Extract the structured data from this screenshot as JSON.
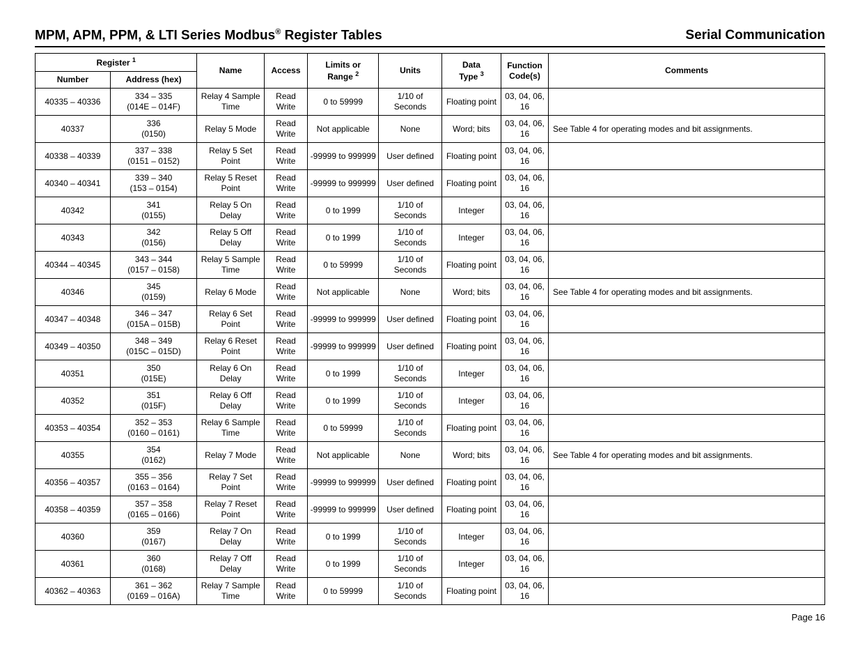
{
  "header": {
    "title_left_prefix": "MPM, APM, PPM, & LTI Series Modbus",
    "title_left_suffix": " Register Tables",
    "reg_mark": "®",
    "title_right": "Serial Communication"
  },
  "footer": {
    "page_label": "Page 16"
  },
  "columns": {
    "register_group": "Register",
    "register_fn": "1",
    "number": "Number",
    "address": "Address (hex)",
    "name": "Name",
    "access": "Access",
    "limits_l1": "Limits or",
    "limits_l2": "Range",
    "limits_fn": "2",
    "units": "Units",
    "data_l1": "Data",
    "data_l2": "Type",
    "data_fn": "3",
    "func_l1": "Function",
    "func_l2": "Code(s)",
    "comments": "Comments"
  },
  "rows": [
    {
      "number": "40335 – 40336",
      "addr1": "334 – 335",
      "addr2": "(014E – 014F)",
      "name": "Relay 4 Sample Time",
      "access": "Read Write",
      "limits": "0 to 59999",
      "units": "1/10 of Seconds",
      "dtype": "Floating point",
      "func": "03, 04, 06, 16",
      "comments": ""
    },
    {
      "number": "40337",
      "addr1": "336",
      "addr2": "(0150)",
      "name": "Relay 5 Mode",
      "access": "Read Write",
      "limits": "Not applicable",
      "units": "None",
      "dtype": "Word; bits",
      "func": "03, 04, 06, 16",
      "comments": "See Table 4 for operating modes and bit assignments."
    },
    {
      "number": "40338 – 40339",
      "addr1": "337 – 338",
      "addr2": "(0151 – 0152)",
      "name": "Relay 5 Set Point",
      "access": "Read Write",
      "limits": "-99999 to 999999",
      "units": "User defined",
      "dtype": "Floating point",
      "func": "03, 04, 06, 16",
      "comments": ""
    },
    {
      "number": "40340 – 40341",
      "addr1": "339 – 340",
      "addr2": "(153 – 0154)",
      "name": "Relay 5 Reset Point",
      "access": "Read Write",
      "limits": "-99999 to 999999",
      "units": "User defined",
      "dtype": "Floating point",
      "func": "03, 04, 06, 16",
      "comments": ""
    },
    {
      "number": "40342",
      "addr1": "341",
      "addr2": "(0155)",
      "name": "Relay 5 On Delay",
      "access": "Read Write",
      "limits": "0 to 1999",
      "units": "1/10 of Seconds",
      "dtype": "Integer",
      "func": "03, 04, 06, 16",
      "comments": ""
    },
    {
      "number": "40343",
      "addr1": "342",
      "addr2": "(0156)",
      "name": "Relay 5 Off Delay",
      "access": "Read Write",
      "limits": "0 to 1999",
      "units": "1/10 of Seconds",
      "dtype": "Integer",
      "func": "03, 04, 06, 16",
      "comments": ""
    },
    {
      "number": "40344 – 40345",
      "addr1": "343 – 344",
      "addr2": "(0157 – 0158)",
      "name": "Relay 5 Sample Time",
      "access": "Read Write",
      "limits": "0 to 59999",
      "units": "1/10 of Seconds",
      "dtype": "Floating point",
      "func": "03, 04, 06, 16",
      "comments": ""
    },
    {
      "number": "40346",
      "addr1": "345",
      "addr2": "(0159)",
      "name": "Relay 6 Mode",
      "access": "Read Write",
      "limits": "Not applicable",
      "units": "None",
      "dtype": "Word; bits",
      "func": "03, 04, 06, 16",
      "comments": "See Table 4 for operating modes and bit assignments."
    },
    {
      "number": "40347 – 40348",
      "addr1": "346 – 347",
      "addr2": "(015A – 015B)",
      "name": "Relay 6 Set Point",
      "access": "Read Write",
      "limits": "-99999 to 999999",
      "units": "User defined",
      "dtype": "Floating point",
      "func": "03, 04, 06, 16",
      "comments": ""
    },
    {
      "number": "40349 – 40350",
      "addr1": "348 – 349",
      "addr2": "(015C – 015D)",
      "name": "Relay 6 Reset Point",
      "access": "Read Write",
      "limits": "-99999 to 999999",
      "units": "User defined",
      "dtype": "Floating point",
      "func": "03, 04, 06, 16",
      "comments": ""
    },
    {
      "number": "40351",
      "addr1": "350",
      "addr2": "(015E)",
      "name": "Relay 6 On Delay",
      "access": "Read Write",
      "limits": "0 to 1999",
      "units": "1/10 of Seconds",
      "dtype": "Integer",
      "func": "03, 04, 06, 16",
      "comments": ""
    },
    {
      "number": "40352",
      "addr1": "351",
      "addr2": "(015F)",
      "name": "Relay 6 Off Delay",
      "access": "Read Write",
      "limits": "0 to 1999",
      "units": "1/10 of Seconds",
      "dtype": "Integer",
      "func": "03, 04, 06, 16",
      "comments": ""
    },
    {
      "number": "40353 – 40354",
      "addr1": "352 – 353",
      "addr2": "(0160 – 0161)",
      "name": "Relay 6 Sample Time",
      "access": "Read Write",
      "limits": "0 to 59999",
      "units": "1/10 of Seconds",
      "dtype": "Floating point",
      "func": "03, 04, 06, 16",
      "comments": ""
    },
    {
      "number": "40355",
      "addr1": "354",
      "addr2": "(0162)",
      "name": "Relay 7 Mode",
      "access": "Read Write",
      "limits": "Not applicable",
      "units": "None",
      "dtype": "Word; bits",
      "func": "03, 04, 06, 16",
      "comments": "See Table 4 for operating modes and bit assignments."
    },
    {
      "number": "40356 – 40357",
      "addr1": "355 – 356",
      "addr2": "(0163 – 0164)",
      "name": "Relay 7 Set Point",
      "access": "Read Write",
      "limits": "-99999 to 999999",
      "units": "User defined",
      "dtype": "Floating point",
      "func": "03, 04, 06, 16",
      "comments": ""
    },
    {
      "number": "40358 – 40359",
      "addr1": "357 – 358",
      "addr2": "(0165 – 0166)",
      "name": "Relay 7 Reset Point",
      "access": "Read Write",
      "limits": "-99999 to 999999",
      "units": "User defined",
      "dtype": "Floating point",
      "func": "03, 04, 06, 16",
      "comments": ""
    },
    {
      "number": "40360",
      "addr1": "359",
      "addr2": "(0167)",
      "name": "Relay 7 On Delay",
      "access": "Read Write",
      "limits": "0 to 1999",
      "units": "1/10 of Seconds",
      "dtype": "Integer",
      "func": "03, 04, 06, 16",
      "comments": ""
    },
    {
      "number": "40361",
      "addr1": "360",
      "addr2": "(0168)",
      "name": "Relay 7 Off Delay",
      "access": "Read Write",
      "limits": "0 to 1999",
      "units": "1/10 of Seconds",
      "dtype": "Integer",
      "func": "03, 04, 06, 16",
      "comments": ""
    },
    {
      "number": "40362 – 40363",
      "addr1": "361 – 362",
      "addr2": "(0169 – 016A)",
      "name": "Relay 7 Sample Time",
      "access": "Read Write",
      "limits": "0 to 59999",
      "units": "1/10 of Seconds",
      "dtype": "Floating point",
      "func": "03, 04, 06, 16",
      "comments": ""
    }
  ]
}
